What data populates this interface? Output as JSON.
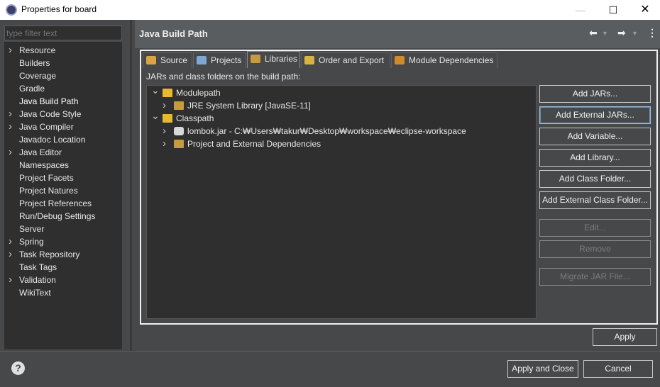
{
  "window": {
    "title": "Properties for board",
    "minimize": "—",
    "maximize": "☐",
    "close": "✕"
  },
  "filter": {
    "placeholder": "type filter text"
  },
  "nav": [
    {
      "label": "Resource",
      "expandable": true
    },
    {
      "label": "Builders",
      "expandable": false
    },
    {
      "label": "Coverage",
      "expandable": false
    },
    {
      "label": "Gradle",
      "expandable": false
    },
    {
      "label": "Java Build Path",
      "expandable": false,
      "selected": true
    },
    {
      "label": "Java Code Style",
      "expandable": true
    },
    {
      "label": "Java Compiler",
      "expandable": true
    },
    {
      "label": "Javadoc Location",
      "expandable": false
    },
    {
      "label": "Java Editor",
      "expandable": true
    },
    {
      "label": "Namespaces",
      "expandable": false
    },
    {
      "label": "Project Facets",
      "expandable": false
    },
    {
      "label": "Project Natures",
      "expandable": false
    },
    {
      "label": "Project References",
      "expandable": false
    },
    {
      "label": "Run/Debug Settings",
      "expandable": false
    },
    {
      "label": "Server",
      "expandable": false
    },
    {
      "label": "Spring",
      "expandable": true
    },
    {
      "label": "Task Repository",
      "expandable": true
    },
    {
      "label": "Task Tags",
      "expandable": false
    },
    {
      "label": "Validation",
      "expandable": true
    },
    {
      "label": "WikiText",
      "expandable": false
    }
  ],
  "page": {
    "title": "Java Build Path",
    "back_icon": "back-arrow-icon",
    "forward_icon": "forward-arrow-icon",
    "menu_icon": "more-menu-icon"
  },
  "tabs": [
    {
      "label": "Source",
      "icon": "source-folder-icon",
      "color": "#d9a441"
    },
    {
      "label": "Projects",
      "icon": "project-icon",
      "color": "#7fa7d6"
    },
    {
      "label": "Libraries",
      "icon": "library-icon",
      "color": "#c69a3e",
      "active": true
    },
    {
      "label": "Order and Export",
      "icon": "order-export-icon",
      "color": "#d9b341"
    },
    {
      "label": "Module Dependencies",
      "icon": "module-icon",
      "color": "#d08a2c"
    }
  ],
  "libraries": {
    "label": "JARs and class folders on the build path:",
    "tree": [
      {
        "text": "Modulepath",
        "level": 0,
        "expanded": true,
        "icon": "modulepath-icon"
      },
      {
        "text": "JRE System Library [JavaSE-11]",
        "level": 1,
        "expanded": false,
        "icon": "jre-library-icon"
      },
      {
        "text": "Classpath",
        "level": 0,
        "expanded": true,
        "icon": "classpath-icon"
      },
      {
        "text": "lombok.jar - C:₩Users₩takur₩Desktop₩workspace₩eclipse-workspace",
        "level": 1,
        "expanded": false,
        "icon": "jar-icon"
      },
      {
        "text": "Project and External Dependencies",
        "level": 1,
        "expanded": false,
        "icon": "dependencies-icon"
      }
    ]
  },
  "buttons": {
    "add_jars": "Add JARs...",
    "add_external_jars": "Add External JARs...",
    "add_variable": "Add Variable...",
    "add_library": "Add Library...",
    "add_class_folder": "Add Class Folder...",
    "add_external_class_folder": "Add External Class Folder...",
    "edit": "Edit...",
    "remove": "Remove",
    "migrate_jar": "Migrate JAR File...",
    "apply": "Apply"
  },
  "footer": {
    "help": "?",
    "apply_and_close": "Apply and Close",
    "cancel": "Cancel"
  }
}
